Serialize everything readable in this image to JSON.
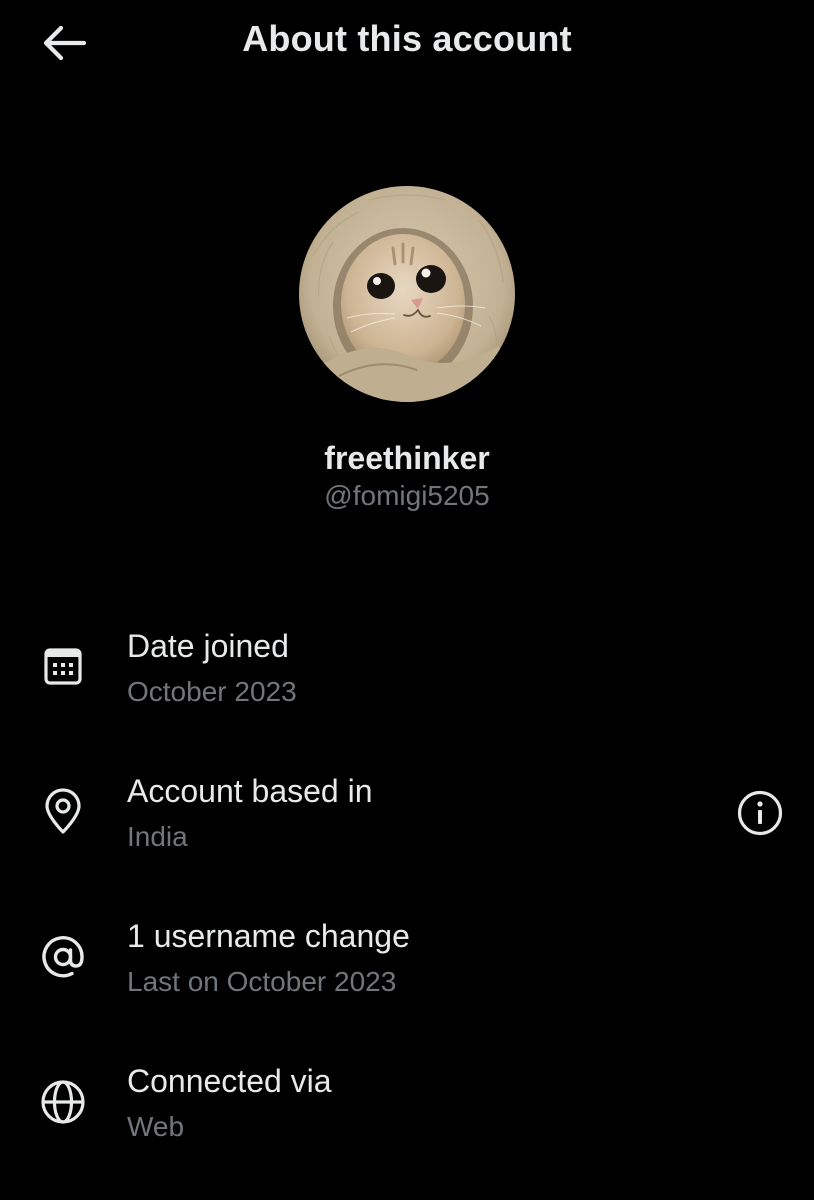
{
  "header": {
    "title": "About this account",
    "back_icon": "arrow-left-icon"
  },
  "profile": {
    "display_name": "freethinker",
    "handle": "@fomigi5205",
    "avatar": "cat-in-hood-avatar"
  },
  "rows": [
    {
      "icon": "calendar-icon",
      "title": "Date joined",
      "subtitle": "October 2023"
    },
    {
      "icon": "location-pin-icon",
      "title": "Account based in",
      "subtitle": "India",
      "trailing_icon": "info-icon"
    },
    {
      "icon": "at-sign-icon",
      "title": "1 username change",
      "subtitle": "Last on October 2023"
    },
    {
      "icon": "globe-icon",
      "title": "Connected via",
      "subtitle": "Web"
    }
  ],
  "colors": {
    "background": "#000000",
    "primary_text": "#e7e9ea",
    "secondary_text": "#71767b"
  }
}
